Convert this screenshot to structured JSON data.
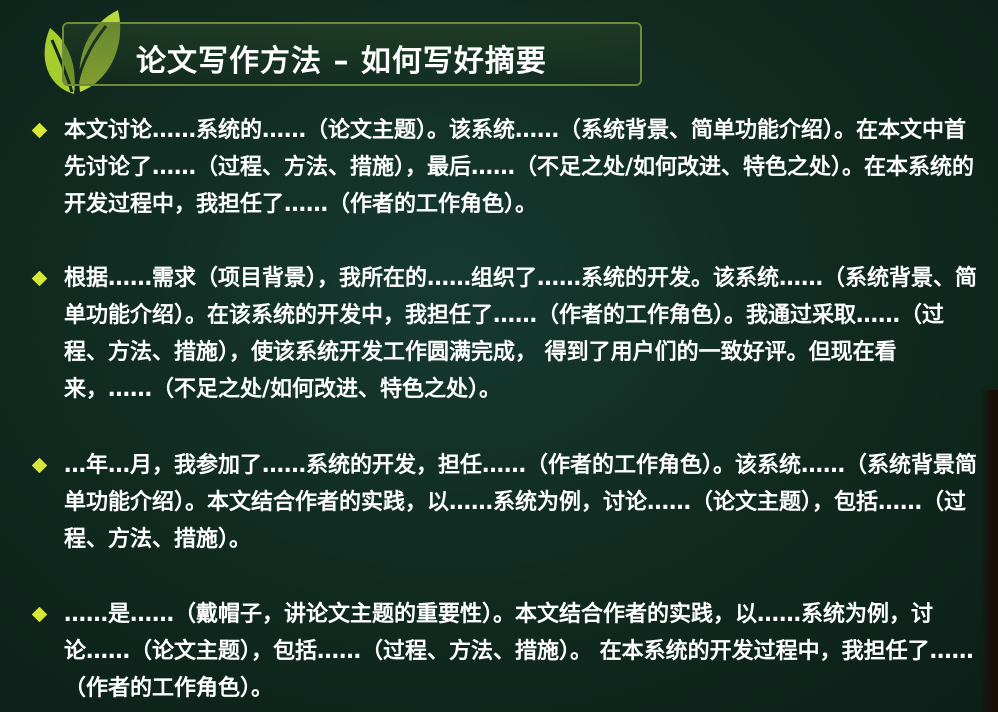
{
  "slide": {
    "title": "论文写作方法 – 如何写好摘要",
    "paragraphs": [
      {
        "text": "本文讨论……系统的……（论文主题）。该系统……（系统背景、简单功能介绍）。在本文中首先讨论了……（过程、方法、措施），最后……（不足之处/如何改进、特色之处）。在本系统的开发过程中，我担任了……（作者的工作角色）。"
      },
      {
        "text": "根据……需求（项目背景），我所在的……组织了……系统的开发。该系统……（系统背景、简单功能介绍）。在该系统的开发中，我担任了……（作者的工作角色）。我通过采取……（过程、方法、措施），使该系统开发工作圆满完成， 得到了用户们的一致好评。但现在看来，……（不足之处/如何改进、特色之处）。"
      },
      {
        "text": "…年…月，我参加了……系统的开发，担任……（作者的工作角色）。该系统……（系统背景简单功能介绍）。本文结合作者的实践，以……系统为例，讨论……（论文主题），包括……（过程、方法、措施）。"
      },
      {
        "text": "……是……（戴帽子，讲论文主题的重要性）。本文结合作者的实践，以……系统为例，讨论……（论文主题），包括……（过程、方法、措施）。 在本系统的开发过程中，我担任了……（作者的工作角色）。"
      }
    ]
  },
  "colors": {
    "background": "#10291f",
    "text": "#ffffff",
    "bullet": "#d8e63a",
    "title_border": "#6e8a3a",
    "logo_leaf": "#a6cc2e"
  },
  "icons": {
    "logo": "leaf-icon",
    "bullet": "diamond-bullet-icon"
  }
}
